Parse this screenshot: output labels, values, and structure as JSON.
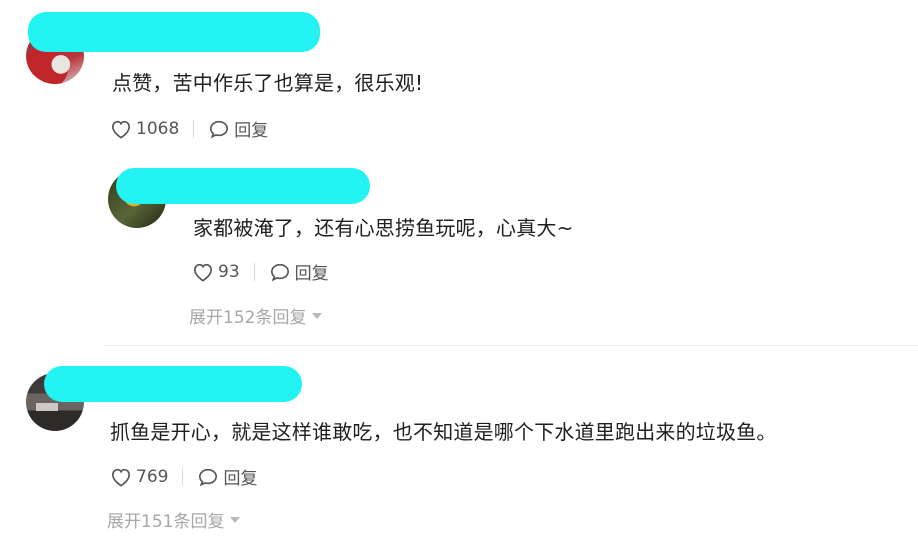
{
  "comments": [
    {
      "text": "点赞，苦中作乐了也算是，很乐观!",
      "likes": "1068",
      "reply_label": "回复"
    },
    {
      "text": "家都被淹了，还有心思捞鱼玩呢，心真大~",
      "likes": "93",
      "reply_label": "回复",
      "expand_label": "展开152条回复"
    },
    {
      "text": "抓鱼是开心，就是这样谁敢吃，也不知道是哪个下水道里跑出来的垃圾鱼。",
      "likes": "769",
      "reply_label": "回复",
      "expand_label": "展开151条回复"
    }
  ],
  "colors": {
    "redaction": "#23f2f2"
  },
  "icons": [
    "heart-icon",
    "comment-bubble-icon",
    "chevron-down-icon"
  ]
}
